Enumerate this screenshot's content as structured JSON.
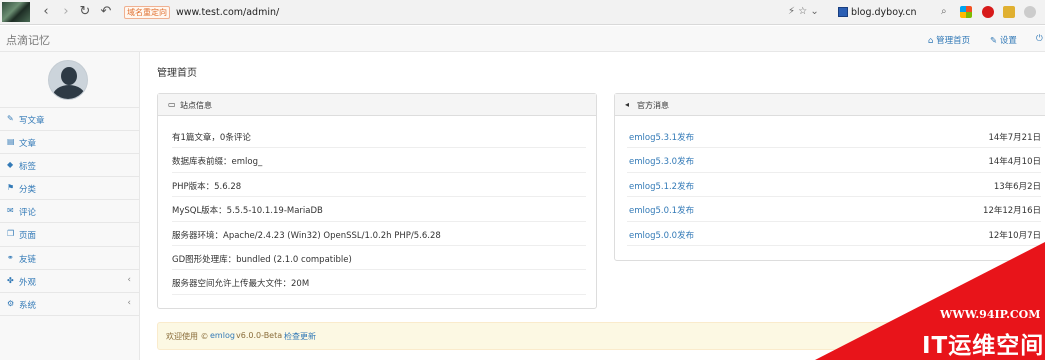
{
  "browser": {
    "back_glyph": "‹",
    "forward_glyph": "›",
    "reload_glyph": "↻",
    "undo_glyph": "↶",
    "redirect_tag": "域名重定向",
    "url": "www.test.com/admin/",
    "right_glyphs": "⚡ ☆  ⌄",
    "ext_site": "blog.dyboy.cn",
    "search_glyph": "⌕"
  },
  "app": {
    "brand": "点滴记忆",
    "nav_home": "管理首页",
    "nav_settings": "设置",
    "nav_home_icon": "home-icon",
    "nav_settings_icon": "wrench-icon"
  },
  "sidebar": {
    "items": [
      {
        "label": "写文章",
        "icon": "✎",
        "has_sub": false
      },
      {
        "label": "文章",
        "icon": "▤",
        "has_sub": false
      },
      {
        "label": "标签",
        "icon": "◆",
        "has_sub": false
      },
      {
        "label": "分类",
        "icon": "⚑",
        "has_sub": false
      },
      {
        "label": "评论",
        "icon": "✉",
        "has_sub": false
      },
      {
        "label": "页面",
        "icon": "❐",
        "has_sub": false
      },
      {
        "label": "友链",
        "icon": "⚭",
        "has_sub": false
      },
      {
        "label": "外观",
        "icon": "✤",
        "has_sub": true,
        "chev": "‹"
      },
      {
        "label": "系统",
        "icon": "⚙",
        "has_sub": true,
        "chev": "‹"
      }
    ]
  },
  "main": {
    "page_title": "管理首页",
    "site_panel": {
      "title": "站点信息",
      "icon": "▭",
      "rows": [
        "有1篇文章，0条评论",
        "数据库表前缀：emlog_",
        "PHP版本：5.6.28",
        "MySQL版本：5.5.5-10.1.19-MariaDB",
        "服务器环境：Apache/2.4.23 (Win32) OpenSSL/1.0.2h PHP/5.6.28",
        "GD图形处理库：bundled (2.1.0 compatible)",
        "服务器空间允许上传最大文件：20M"
      ]
    },
    "news_panel": {
      "title": "官方消息",
      "icon": "◂",
      "rows": [
        {
          "title": "emlog5.3.1发布",
          "date": "14年7月21日"
        },
        {
          "title": "emlog5.3.0发布",
          "date": "14年4月10日"
        },
        {
          "title": "emlog5.1.2发布",
          "date": "13年6月2日"
        },
        {
          "title": "emlog5.0.1发布",
          "date": "12年12月16日"
        },
        {
          "title": "emlog5.0.0发布",
          "date": "12年10月7日"
        }
      ]
    },
    "footer": {
      "welcome": "欢迎使用 ©",
      "product_link": "emlog",
      "version": "v6.0.0-Beta",
      "update_link": "检查更新"
    }
  },
  "watermark": {
    "url": "WWW.94IP.COM",
    "name": "IT运维空间"
  },
  "colors": {
    "link": "#337ab7",
    "watermark_red": "#e8141a"
  }
}
